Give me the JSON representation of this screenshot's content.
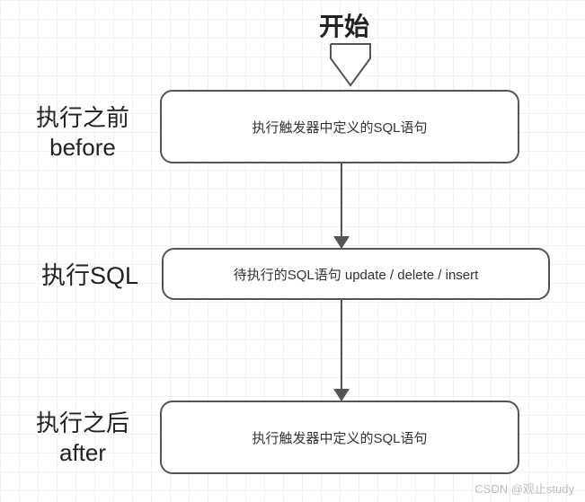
{
  "start_label": "开始",
  "side_labels": {
    "before": {
      "line1": "执行之前",
      "line2": "before"
    },
    "exec": {
      "line1": "执行SQL"
    },
    "after": {
      "line1": "执行之后",
      "line2": "after"
    }
  },
  "nodes": {
    "before_box": "执行触发器中定义的SQL语句",
    "exec_box": "待执行的SQL语句  update / delete / insert",
    "after_box": "执行触发器中定义的SQL语句"
  },
  "watermark": "CSDN @观止study"
}
